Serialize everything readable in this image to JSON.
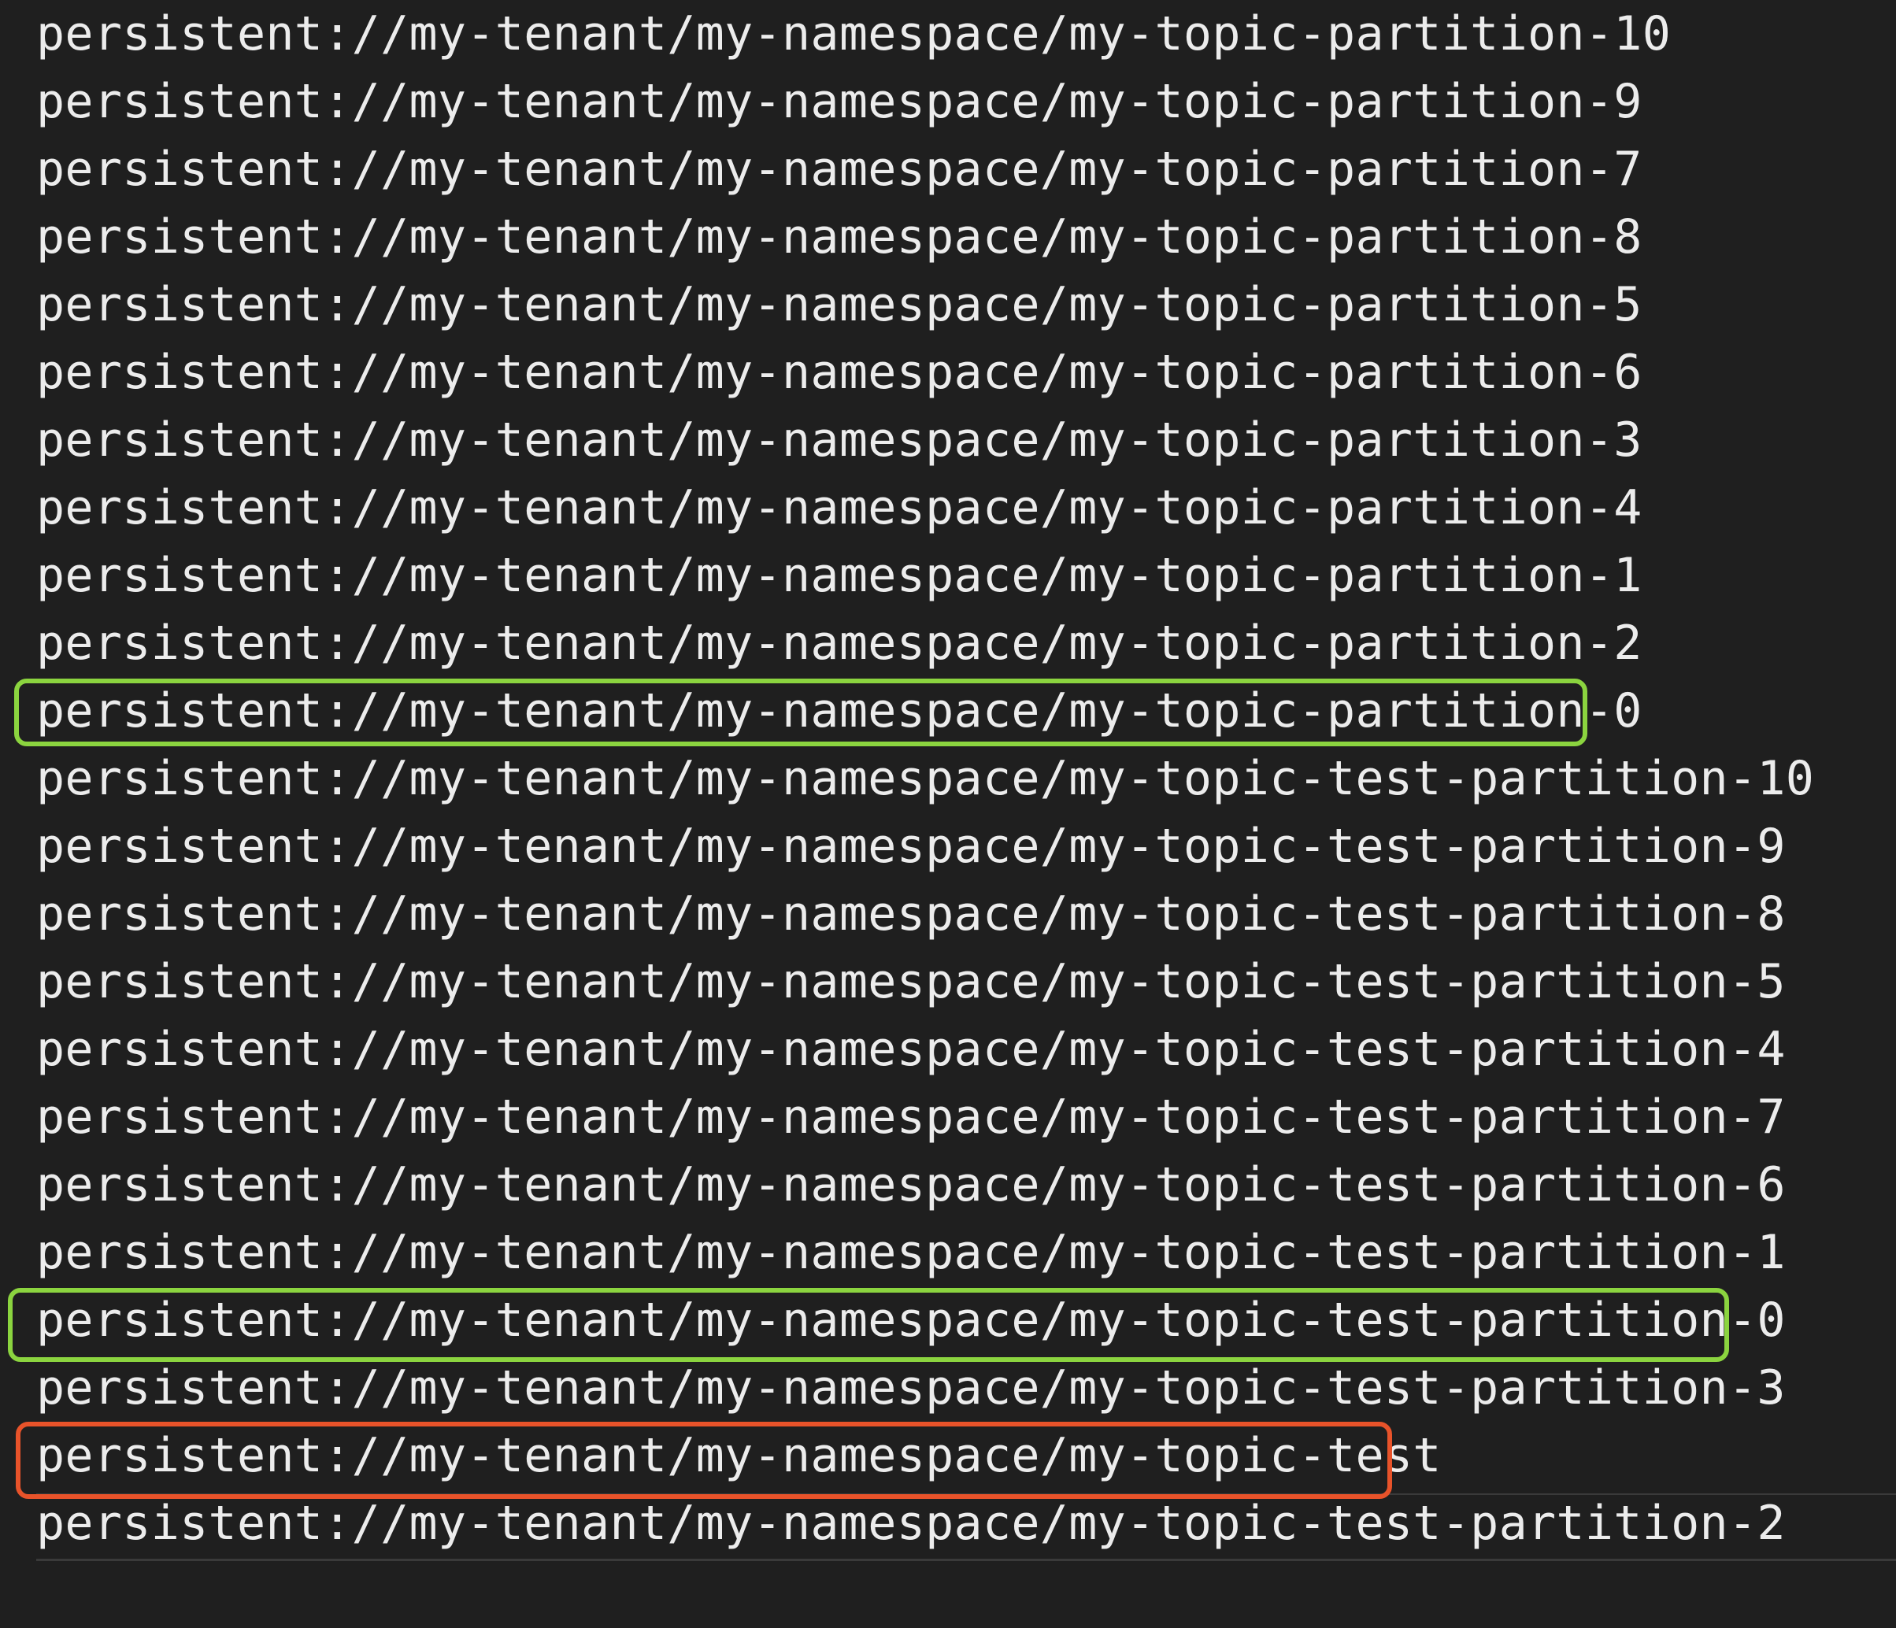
{
  "terminal": {
    "lines": [
      "persistent://my-tenant/my-namespace/my-topic-partition-10",
      "persistent://my-tenant/my-namespace/my-topic-partition-9",
      "persistent://my-tenant/my-namespace/my-topic-partition-7",
      "persistent://my-tenant/my-namespace/my-topic-partition-8",
      "persistent://my-tenant/my-namespace/my-topic-partition-5",
      "persistent://my-tenant/my-namespace/my-topic-partition-6",
      "persistent://my-tenant/my-namespace/my-topic-partition-3",
      "persistent://my-tenant/my-namespace/my-topic-partition-4",
      "persistent://my-tenant/my-namespace/my-topic-partition-1",
      "persistent://my-tenant/my-namespace/my-topic-partition-2",
      "persistent://my-tenant/my-namespace/my-topic-partition-0",
      "persistent://my-tenant/my-namespace/my-topic-test-partition-10",
      "persistent://my-tenant/my-namespace/my-topic-test-partition-9",
      "persistent://my-tenant/my-namespace/my-topic-test-partition-8",
      "persistent://my-tenant/my-namespace/my-topic-test-partition-5",
      "persistent://my-tenant/my-namespace/my-topic-test-partition-4",
      "persistent://my-tenant/my-namespace/my-topic-test-partition-7",
      "persistent://my-tenant/my-namespace/my-topic-test-partition-6",
      "persistent://my-tenant/my-namespace/my-topic-test-partition-1",
      "persistent://my-tenant/my-namespace/my-topic-test-partition-0",
      "persistent://my-tenant/my-namespace/my-topic-test-partition-3",
      "persistent://my-tenant/my-namespace/my-topic-test",
      "persistent://my-tenant/my-namespace/my-topic-test-partition-2"
    ],
    "highlighted_green": [
      "persistent://my-tenant/my-namespace/my-topic-partition-0",
      "persistent://my-tenant/my-namespace/my-topic-test-partition-0"
    ],
    "highlighted_red": [
      "persistent://my-tenant/my-namespace/my-topic-test"
    ]
  },
  "colors": {
    "background": "#1f1f1f",
    "text": "#ececec",
    "highlight_green": "#8bd43f",
    "highlight_red": "#e8532a"
  }
}
